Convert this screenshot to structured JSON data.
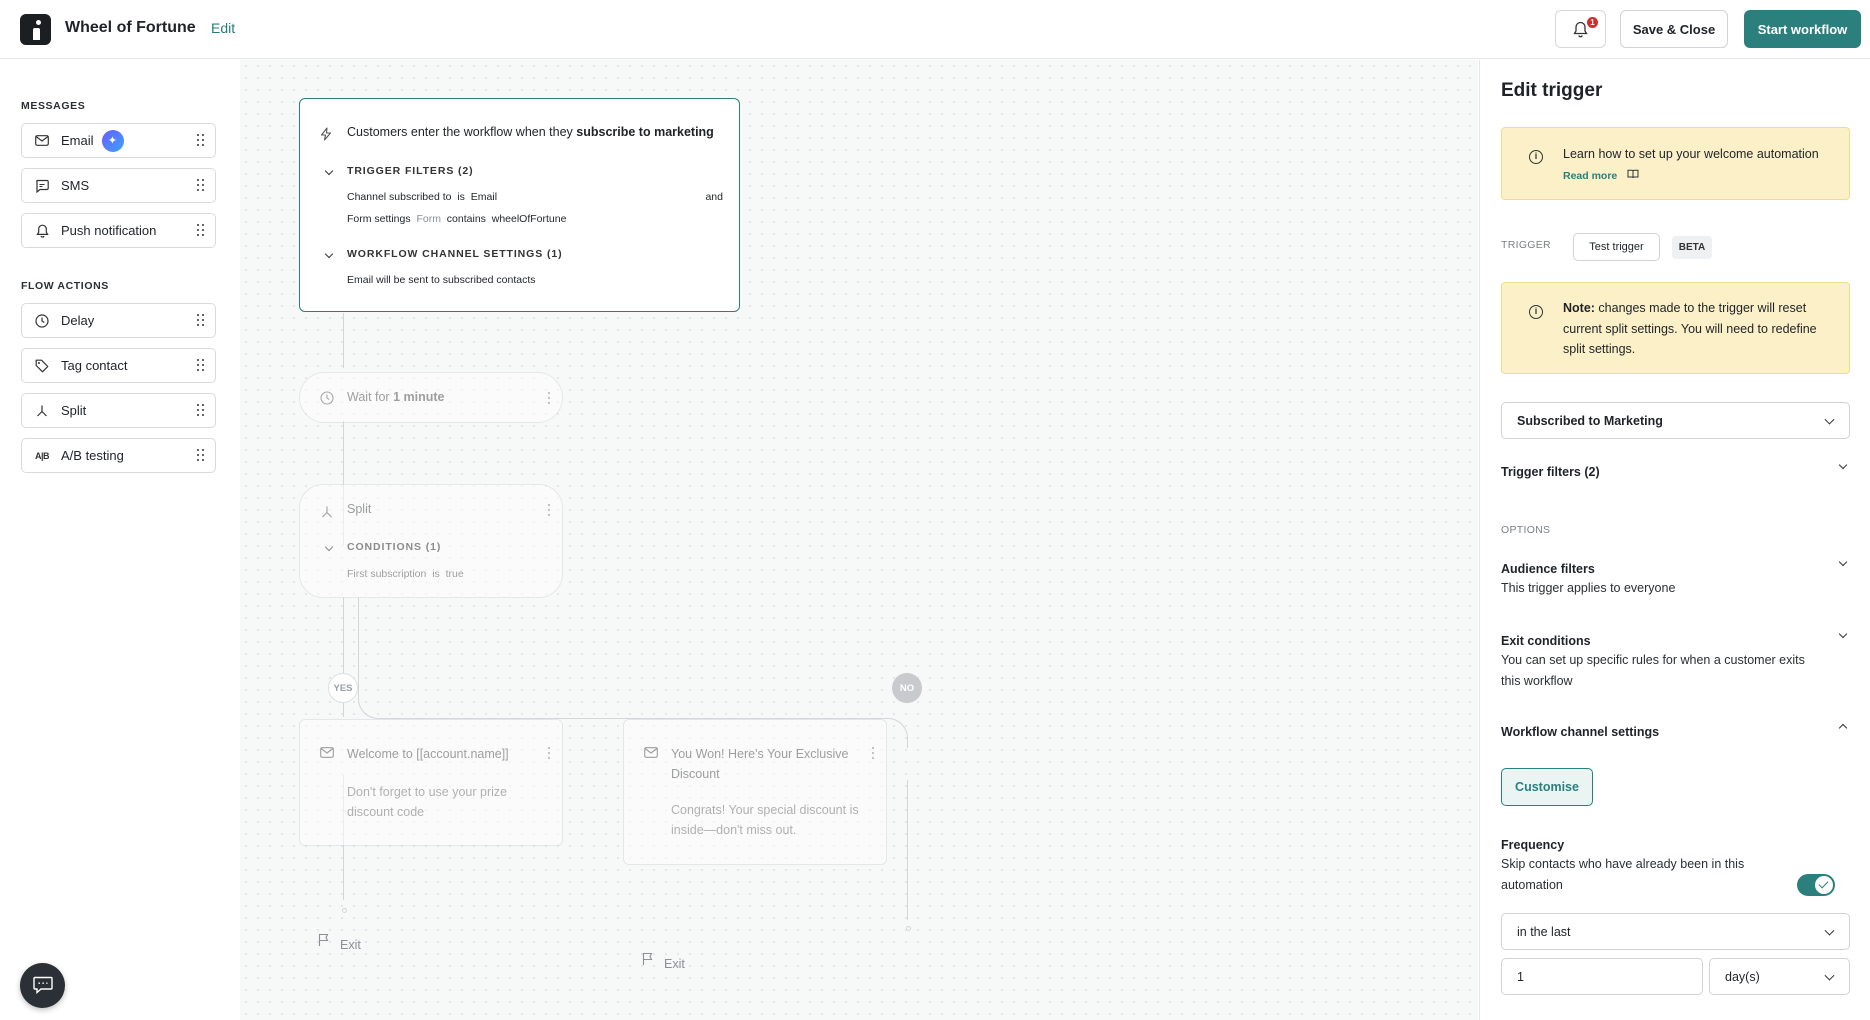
{
  "header": {
    "title": "Wheel of Fortune",
    "edit_label": "Edit",
    "notification_count": "1",
    "save_close_label": "Save & Close",
    "start_label": "Start workflow"
  },
  "palette": {
    "messages_heading": "MESSAGES",
    "messages": [
      {
        "label": "Email",
        "icon": "mail-icon"
      },
      {
        "label": "SMS",
        "icon": "chat-bubble-icon"
      },
      {
        "label": "Push notification",
        "icon": "bell-icon"
      }
    ],
    "flow_heading": "FLOW ACTIONS",
    "flow_actions": [
      {
        "label": "Delay",
        "icon": "clock-icon"
      },
      {
        "label": "Tag contact",
        "icon": "tag-icon"
      },
      {
        "label": "Split",
        "icon": "split-icon"
      },
      {
        "label": "A/B testing",
        "icon": "ab-icon",
        "icon_text": "A|B"
      }
    ]
  },
  "workflow": {
    "trigger": {
      "text_prefix": "Customers enter the workflow when they ",
      "text_bold": "subscribe to marketing",
      "filters_heading": "TRIGGER FILTERS (2)",
      "filter1": {
        "field": "Channel subscribed to",
        "op": "is",
        "value": "Email",
        "join": "and"
      },
      "filter2": {
        "field": "Form settings",
        "type": "Form",
        "op": "contains",
        "value": "wheelOfFortune"
      },
      "channel_heading": "WORKFLOW CHANNEL SETTINGS (1)",
      "channel_text": "Email will be sent to subscribed contacts"
    },
    "wait": {
      "prefix": "Wait for ",
      "value": "1 minute"
    },
    "split": {
      "title": "Split",
      "conditions_heading": "CONDITIONS (1)",
      "cond_field": "First subscription",
      "cond_op": "is",
      "cond_value": "true"
    },
    "yes_label": "YES",
    "no_label": "NO",
    "email_yes": {
      "title": "Welcome to [[account.name]]",
      "body": "Don't forget to use your prize discount code"
    },
    "email_no": {
      "title": "You Won! Here's Your Exclusive Discount",
      "body": "Congrats! Your special discount is inside—don't miss out."
    },
    "exit_label": "Exit"
  },
  "panel": {
    "title": "Edit trigger",
    "help_text": "Learn how to set up your welcome automation ",
    "read_more": "Read more",
    "trigger_label": "TRIGGER",
    "test_trigger": "Test trigger",
    "beta": "BETA",
    "note_bold": "Note:",
    "note_text": " changes made to the trigger will reset current split settings. You will need to redefine split settings.",
    "trigger_select": "Subscribed to Marketing",
    "trigger_filters": "Trigger filters (2)",
    "options_label": "OPTIONS",
    "audience_title": "Audience filters",
    "audience_desc": "This trigger applies to everyone",
    "exit_title": "Exit conditions",
    "exit_desc": "You can set up specific rules for when a customer exits this workflow",
    "channel_title": "Workflow channel settings",
    "customise": "Customise",
    "frequency_title": "Frequency",
    "frequency_desc": "Skip contacts who have already been in this automation",
    "frequency_enabled": true,
    "period_select": "in the last",
    "period_value": "1",
    "period_unit": "day(s)"
  },
  "colors": {
    "accent": "#2b7f7d",
    "note_bg": "#fbf0c8",
    "badge": "#d02c2c"
  }
}
